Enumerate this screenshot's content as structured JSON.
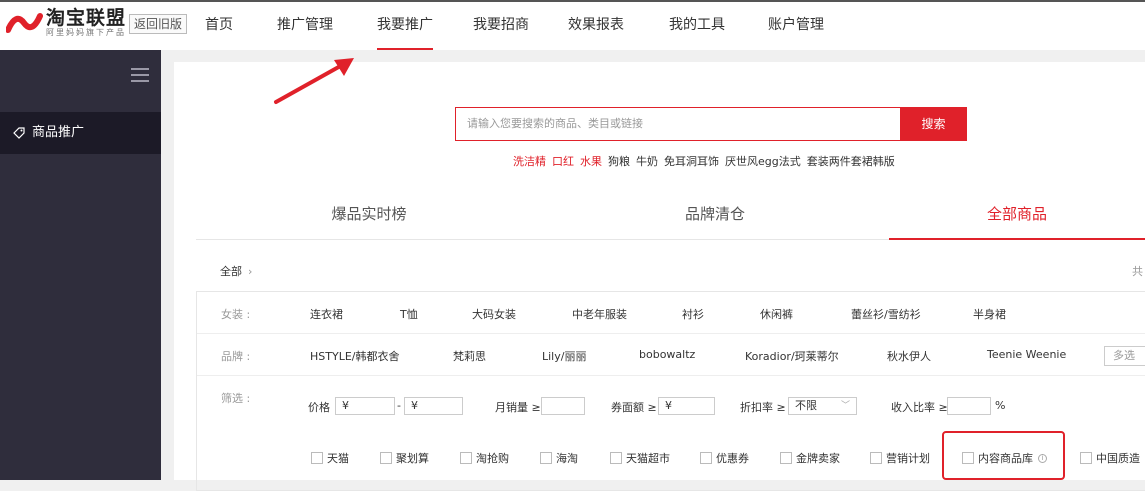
{
  "header": {
    "logo_name": "淘宝联盟",
    "logo_sub": "阿里妈妈旗下产品",
    "old_version_label": "返回旧版",
    "nav": [
      {
        "label": "首页"
      },
      {
        "label": "推广管理"
      },
      {
        "label": "我要推广"
      },
      {
        "label": "我要招商"
      },
      {
        "label": "效果报表"
      },
      {
        "label": "我的工具"
      },
      {
        "label": "账户管理"
      }
    ],
    "active_index": 2
  },
  "sidebar": {
    "items": [
      {
        "label": "商品推广"
      }
    ]
  },
  "search": {
    "placeholder": "请输入您要搜索的商品、类目或链接",
    "button_label": "搜索",
    "hot_words": [
      {
        "label": "洗洁精",
        "highlight": true
      },
      {
        "label": "口红",
        "highlight": true
      },
      {
        "label": "水果",
        "highlight": true
      },
      {
        "label": "狗粮",
        "highlight": false
      },
      {
        "label": "牛奶",
        "highlight": false
      },
      {
        "label": "免耳洞耳饰",
        "highlight": false
      },
      {
        "label": "厌世风egg法式",
        "highlight": false
      },
      {
        "label": "套装两件套裙韩版",
        "highlight": false
      }
    ]
  },
  "tabs": [
    {
      "label": "爆品实时榜"
    },
    {
      "label": "品牌清仓"
    },
    {
      "label": "全部商品"
    }
  ],
  "breadcrumb": {
    "label": "全部",
    "chevron": "›"
  },
  "total_label": "共",
  "filters": {
    "category": {
      "label": "女装 :",
      "items": [
        "连衣裙",
        "T恤",
        "大码女装",
        "中老年服装",
        "衬衫",
        "休闲裤",
        "蕾丝衫/雪纺衫",
        "半身裙"
      ]
    },
    "brand": {
      "label": "品牌 :",
      "items": [
        "HSTYLE/韩都衣舍",
        "梵莉思",
        "Lily/丽丽",
        "bobowaltz",
        "Koradior/珂莱蒂尔",
        "秋水伊人",
        "Teenie Weenie"
      ],
      "more_label": "多选"
    },
    "screen": {
      "label": "筛选 :",
      "price_label": "价格",
      "price_from": "¥",
      "price_sep": "-",
      "price_to": "¥",
      "sales_label": "月销量 ≥",
      "coupon_label": "券面额 ≥",
      "coupon_value": "¥",
      "discount_label": "折扣率 ≥",
      "discount_value": "不限",
      "income_label": "收入比率 ≥",
      "income_unit": "%",
      "checkboxes": [
        "天猫",
        "聚划算",
        "淘抢购",
        "海淘",
        "天猫超市",
        "优惠券",
        "金牌卖家",
        "营销计划",
        "内容商品库",
        "中国质造"
      ]
    }
  },
  "colors": {
    "accent": "#e0212a",
    "sidebar": "#2f2d3c",
    "sidebar_active": "#1c1a27"
  }
}
